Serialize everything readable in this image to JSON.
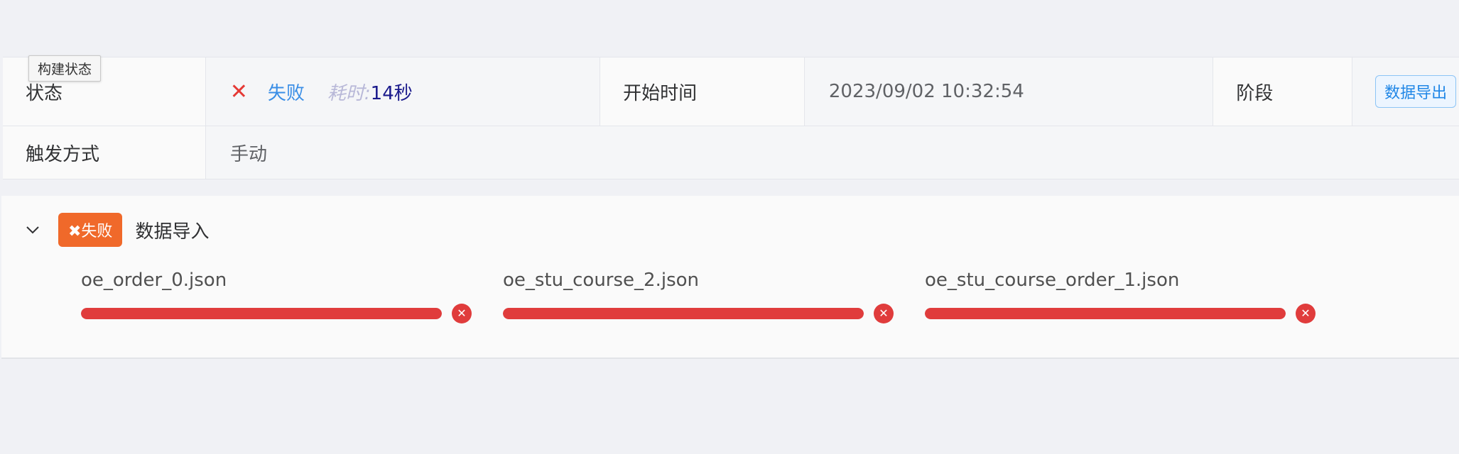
{
  "tooltip": "构建状态",
  "details": {
    "status_label": "状态",
    "status_icon": "close-icon",
    "status_value": "失败",
    "elapsed_label": "耗时:",
    "elapsed_value": "14秒",
    "start_time_label": "开始时间",
    "start_time_value": "2023/09/02 10:32:54",
    "stage_label": "阶段",
    "stage_tag": "数据导出",
    "trigger_label": "触发方式",
    "trigger_value": "手动"
  },
  "stage_panel": {
    "collapse_icon": "chevron-down-icon",
    "status_tag": "✖失败",
    "title": "数据导入",
    "files": [
      {
        "name": "oe_order_0.json",
        "progress": 1.0,
        "status": "error"
      },
      {
        "name": "oe_stu_course_2.json",
        "progress": 1.0,
        "status": "error"
      },
      {
        "name": "oe_stu_course_order_1.json",
        "progress": 1.0,
        "status": "error"
      }
    ]
  },
  "colors": {
    "error": "#e03c3c",
    "fail_tag": "#f0692a",
    "link_blue": "#3a8ee6"
  }
}
